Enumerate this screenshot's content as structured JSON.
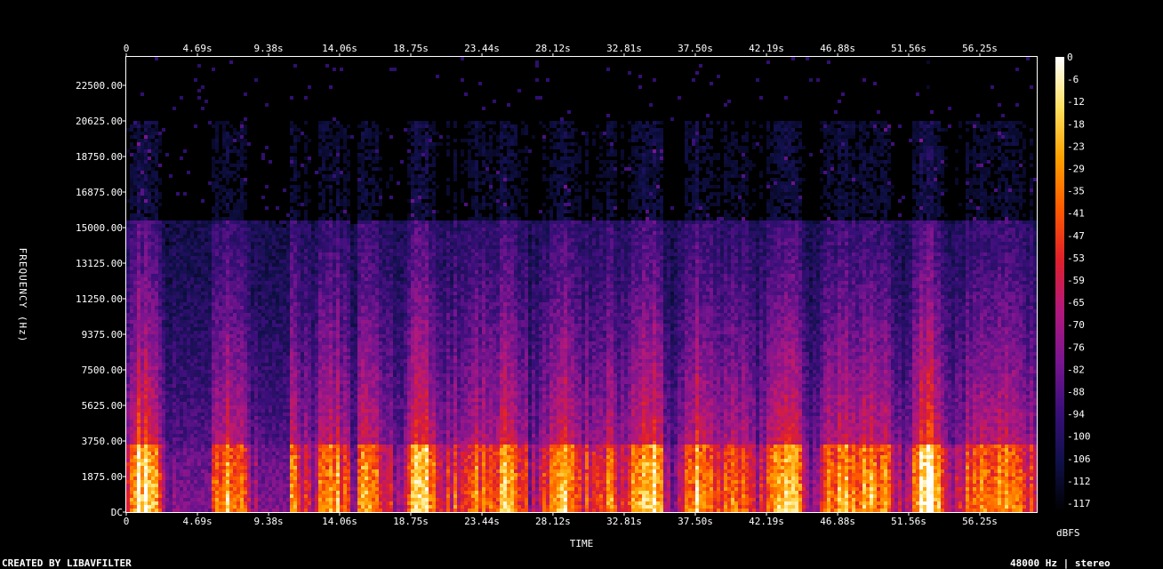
{
  "chart_data": {
    "type": "heatmap",
    "kind": "spectrogram",
    "x_ticks": [
      "0",
      "4.69s",
      "9.38s",
      "14.06s",
      "18.75s",
      "23.44s",
      "28.12s",
      "32.81s",
      "37.50s",
      "42.19s",
      "46.88s",
      "51.56s",
      "56.25s"
    ],
    "x_tick_values": [
      0,
      4.69,
      9.38,
      14.06,
      18.75,
      23.44,
      28.12,
      32.81,
      37.5,
      42.19,
      46.88,
      51.56,
      56.25
    ],
    "xlim": [
      0,
      60
    ],
    "xlabel": "TIME",
    "y_ticks": [
      "DC",
      "1875.00",
      "3750.00",
      "5625.00",
      "7500.00",
      "9375.00",
      "11250.00",
      "13125.00",
      "15000.00",
      "16875.00",
      "18750.00",
      "20625.00",
      "22500.00"
    ],
    "y_tick_values": [
      0,
      1875,
      3750,
      5625,
      7500,
      9375,
      11250,
      13125,
      15000,
      16875,
      18750,
      20625,
      22500
    ],
    "ylim": [
      0,
      24000
    ],
    "ylabel": "FREQUENCY (Hz)",
    "colorbar": {
      "label": "dBFS",
      "ticks": [
        "0",
        "-6",
        "-12",
        "-18",
        "-23",
        "-29",
        "-35",
        "-41",
        "-47",
        "-53",
        "-59",
        "-65",
        "-70",
        "-76",
        "-82",
        "-88",
        "-94",
        "-100",
        "-106",
        "-112",
        "-117"
      ],
      "range": [
        -120,
        0
      ],
      "colors": [
        "#000000",
        "#10104a",
        "#3a0f7a",
        "#7a1590",
        "#b3187c",
        "#e0202a",
        "#ff5a00",
        "#ffa000",
        "#ffe060",
        "#ffffff"
      ]
    },
    "quiet_segments_s": [
      [
        3.2,
        5.4
      ],
      [
        8.5,
        10.7
      ],
      [
        14.6,
        15.2
      ]
    ],
    "lowpass_cutoff_hz": 15500
  },
  "footer": {
    "left": "CREATED BY LIBAVFILTER",
    "right": "48000 Hz | stereo"
  }
}
